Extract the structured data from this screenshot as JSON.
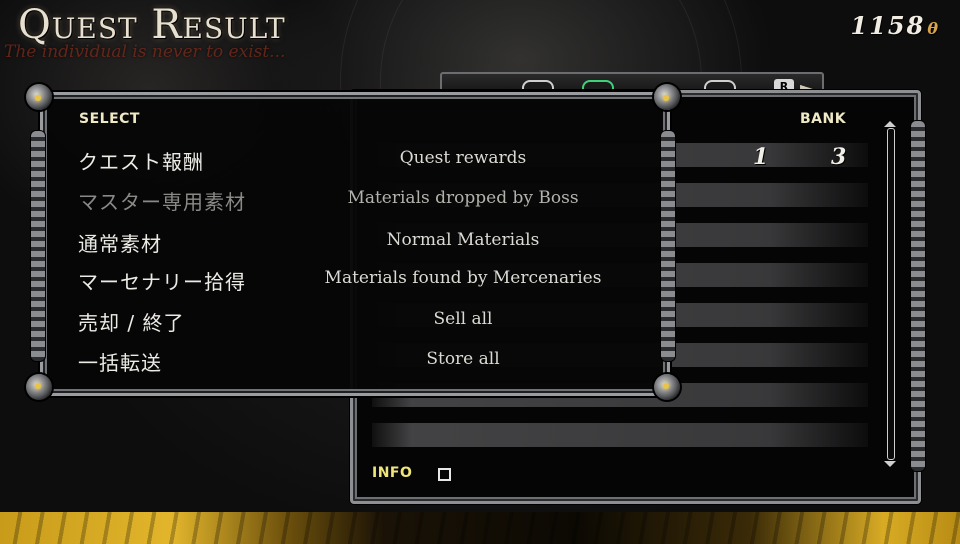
{
  "header": {
    "title": "Quest Result",
    "subtitle": "The individual is never to exist...",
    "money": "1158",
    "money_unit": "θ"
  },
  "select_panel": {
    "label": "SELECT",
    "items": [
      {
        "jp": "クエスト報酬",
        "en": "Quest rewards",
        "enabled": true
      },
      {
        "jp": "マスター専用素材",
        "en": "Materials dropped by Boss",
        "enabled": false
      },
      {
        "jp": "通常素材",
        "en": "Normal Materials",
        "enabled": true
      },
      {
        "jp": "マーセナリー拾得",
        "en": "Materials found by Mercenaries",
        "enabled": true
      },
      {
        "jp": "売却 / 終了",
        "en": "Sell all",
        "enabled": true
      },
      {
        "jp": "一括転送",
        "en": "Store all",
        "enabled": true
      }
    ]
  },
  "bank_panel": {
    "label": "BANK",
    "first_row_values": [
      "1",
      "3"
    ],
    "info_label": "INFO",
    "tab_button": "R"
  },
  "colors": {
    "accent_gold": "#e8c44a",
    "label_yellow": "#efe47a",
    "frame_silver": "#9a9c9f"
  }
}
